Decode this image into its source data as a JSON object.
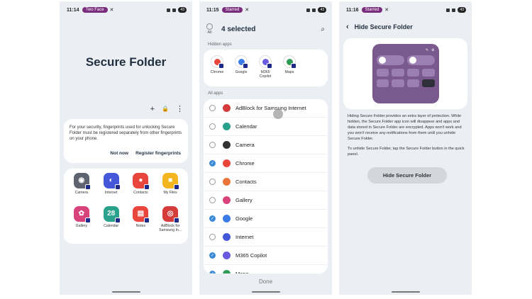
{
  "panel1": {
    "status": {
      "time": "11:14",
      "pill": "Two Face",
      "battery": "43"
    },
    "title": "Secure Folder",
    "actions": {
      "add": "+",
      "lock": "🔒",
      "more": "⋮"
    },
    "note": {
      "text": "For your security, fingerprints used for unlocking Secure Folder must be registered separately from other fingerprints on your phone.",
      "not_now": "Not now",
      "register": "Register fingerprints"
    },
    "apps": [
      {
        "label": "Camera",
        "color": "#5d6470",
        "glyph": "◉"
      },
      {
        "label": "Internet",
        "color": "#4457d9",
        "glyph": "◐"
      },
      {
        "label": "Contacts",
        "color": "#e8453c",
        "glyph": "●"
      },
      {
        "label": "My Files",
        "color": "#f3b61f",
        "glyph": "■"
      },
      {
        "label": "Gallery",
        "color": "#d9437b",
        "glyph": "✿"
      },
      {
        "label": "Calendar",
        "color": "#2aa18b",
        "glyph": "28"
      },
      {
        "label": "Notes",
        "color": "#e8453c",
        "glyph": "▤"
      },
      {
        "label": "AdBlock for Samsung In...",
        "color": "#d63b3b",
        "glyph": "◎"
      }
    ]
  },
  "panel2": {
    "status": {
      "time": "11:15",
      "pill": "Starred",
      "battery": "43"
    },
    "all_label": "All",
    "selected": "4 selected",
    "hidden_section": "Hidden apps",
    "hidden_apps": [
      {
        "label": "Chrome",
        "color": "#e9453a"
      },
      {
        "label": "Google",
        "color": "#3b7be8"
      },
      {
        "label": "M365 Copilot",
        "color": "#6a5be0"
      },
      {
        "label": "Maps",
        "color": "#2e9c55"
      }
    ],
    "all_section": "All apps",
    "list": [
      {
        "label": "AdBlock for Samsung Internet",
        "checked": false,
        "color": "#d63b3b"
      },
      {
        "label": "Calendar",
        "checked": false,
        "color": "#2aa18b"
      },
      {
        "label": "Camera",
        "checked": false,
        "color": "#333333"
      },
      {
        "label": "Chrome",
        "checked": true,
        "color": "#e9453a"
      },
      {
        "label": "Contacts",
        "checked": false,
        "color": "#e8743c"
      },
      {
        "label": "Gallery",
        "checked": false,
        "color": "#d9437b"
      },
      {
        "label": "Google",
        "checked": true,
        "color": "#3b7be8"
      },
      {
        "label": "Internet",
        "checked": false,
        "color": "#4457d9"
      },
      {
        "label": "M365 Copilot",
        "checked": true,
        "color": "#6a5be0"
      },
      {
        "label": "Maps",
        "checked": true,
        "color": "#2e9c55"
      }
    ],
    "done": "Done"
  },
  "panel3": {
    "status": {
      "time": "11:16",
      "pill": "Starred",
      "battery": "43"
    },
    "title": "Hide Secure Folder",
    "para1": "Hiding Secure Folder provides an extra layer of protection. While hidden, the Secure Folder app icon will disappear and apps and data stored in Secure Folder are encrypted. Apps won't work and you won't receive any notifications from them until you unhide Secure Folder.",
    "para2": "To unhide Secure Folder, tap the Secure Folder button in the quick panel.",
    "button": "Hide Secure Folder"
  }
}
